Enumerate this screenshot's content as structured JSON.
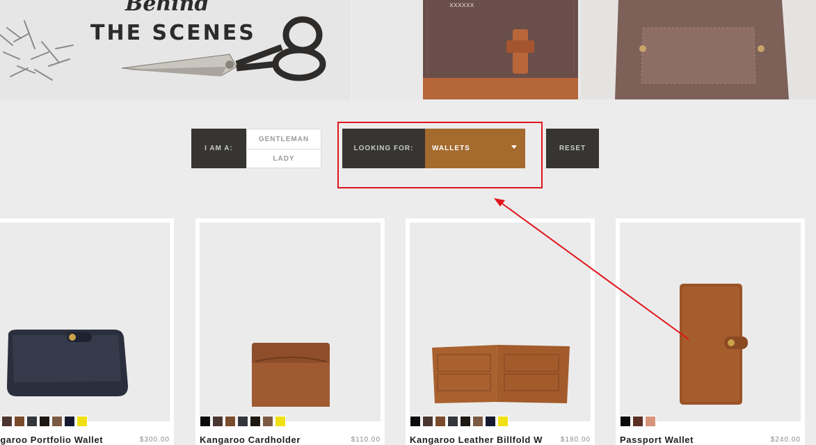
{
  "hero": {
    "script_text": "Behind",
    "title": "THE SCENES"
  },
  "filters": {
    "iam_label": "I AM A:",
    "gender_options": [
      "GENTLEMAN",
      "LADY"
    ],
    "looking_label": "LOOKING FOR:",
    "looking_value": "WALLETS",
    "reset_label": "RESET"
  },
  "colors": {
    "accent": "#a46a2e",
    "dark": "#363532",
    "annotation": "#e0141b"
  },
  "products": [
    {
      "name": "angaroo Portfolio Wallet",
      "price": "$300.00",
      "swatches": [
        "#0b0b0b",
        "#4b3631",
        "#7a4b2c",
        "#33373c",
        "#1e1812",
        "#7b5a43",
        "#161a30",
        "#f0e014"
      ]
    },
    {
      "name": "Kangaroo Cardholder",
      "price": "$110.00",
      "swatches": [
        "#0b0b0b",
        "#4b3631",
        "#7a4b2c",
        "#33373c",
        "#1e1812",
        "#7b5a43",
        "#f0e014"
      ]
    },
    {
      "name": "Kangaroo Leather Billfold W",
      "price": "$180.00",
      "swatches": [
        "#0b0b0b",
        "#4b3631",
        "#7a4b2c",
        "#33373c",
        "#1e1812",
        "#7b5a43",
        "#161a30",
        "#f0e014"
      ]
    },
    {
      "name": "Passport Wallet",
      "price": "$240.00",
      "swatches": [
        "#0b0b0b",
        "#5a2f24",
        "#d6957a"
      ]
    }
  ]
}
